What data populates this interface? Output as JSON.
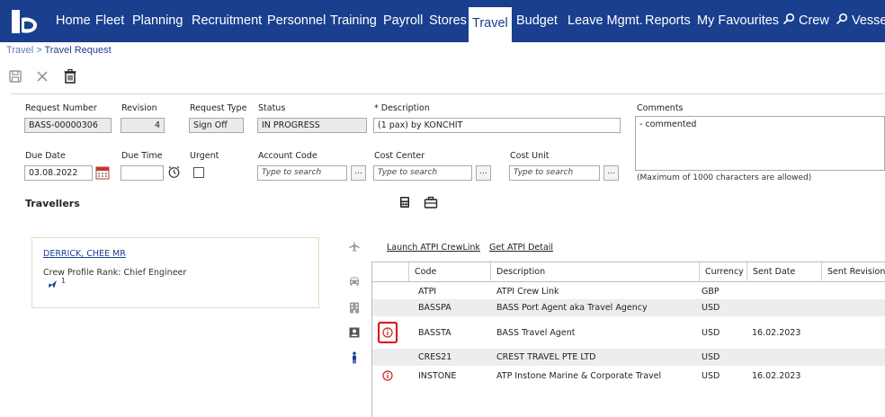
{
  "nav": {
    "items": [
      "Home",
      "Fleet",
      "Planning",
      "Recruitment",
      "Personnel",
      "Training",
      "Payroll",
      "Stores",
      "Travel",
      "Budget",
      "Leave Mgmt.",
      "Reports",
      "My Favourites"
    ],
    "search_items": [
      "Crew",
      "Vessel"
    ],
    "active": "Travel",
    "color": "#1a3f8f"
  },
  "breadcrumb": {
    "parent": "Travel",
    "separator": " > ",
    "current": "Travel Request"
  },
  "toolbar": {
    "icons": [
      "save-icon",
      "close-icon",
      "delete-icon"
    ]
  },
  "form": {
    "request_number": {
      "label": "Request Number",
      "value": "BASS-00000306"
    },
    "revision": {
      "label": "Revision",
      "value": "4"
    },
    "request_type": {
      "label": "Request Type",
      "value": "Sign Off"
    },
    "status": {
      "label": "Status",
      "value": "IN PROGRESS"
    },
    "description": {
      "label": "* Description",
      "value": "(1 pax) by KONCHIT"
    },
    "comments": {
      "label": "Comments",
      "value": "- commented",
      "note": "(Maximum of 1000 characters are allowed)"
    },
    "due_date": {
      "label": "Due Date",
      "value": "03.08.2022"
    },
    "due_time": {
      "label": "Due Time",
      "value": ""
    },
    "urgent": {
      "label": "Urgent",
      "checked": false
    },
    "account_code": {
      "label": "Account Code",
      "placeholder": "Type to search"
    },
    "cost_center": {
      "label": "Cost Center",
      "placeholder": "Type to search"
    },
    "cost_unit": {
      "label": "Cost Unit",
      "placeholder": "Type to search"
    },
    "dots": "..."
  },
  "travellers": {
    "title": "Travellers",
    "card": {
      "name": "DERRICK, CHEE MR",
      "rank": "Crew Profile Rank: Chief Engineer",
      "flight_count": "1"
    }
  },
  "links": {
    "launch": "Launch ATPI CrewLink",
    "detail": "Get ATPI Detail"
  },
  "grid": {
    "columns": [
      "Code",
      "Description",
      "Currency",
      "Sent Date",
      "Sent Revision"
    ],
    "rows": [
      {
        "info": false,
        "code": "ATPI",
        "description": "ATPI Crew Link",
        "currency": "GBP",
        "sent_date": "",
        "sent_revision": ""
      },
      {
        "info": false,
        "code": "BASSPA",
        "description": "BASS Port Agent aka Travel Agency",
        "currency": "USD",
        "sent_date": "",
        "sent_revision": ""
      },
      {
        "info": true,
        "code": "BASSTA",
        "description": "BASS Travel Agent",
        "currency": "USD",
        "sent_date": "16.02.2023",
        "sent_revision": ""
      },
      {
        "info": false,
        "code": "CRES21",
        "description": "CREST TRAVEL PTE LTD",
        "currency": "USD",
        "sent_date": "",
        "sent_revision": ""
      },
      {
        "info": true,
        "code": "INSTONE",
        "description": "ATP Instone Marine & Corporate Travel",
        "currency": "USD",
        "sent_date": "16.02.2023",
        "sent_revision": ""
      }
    ],
    "info_color": "#cc2222"
  }
}
